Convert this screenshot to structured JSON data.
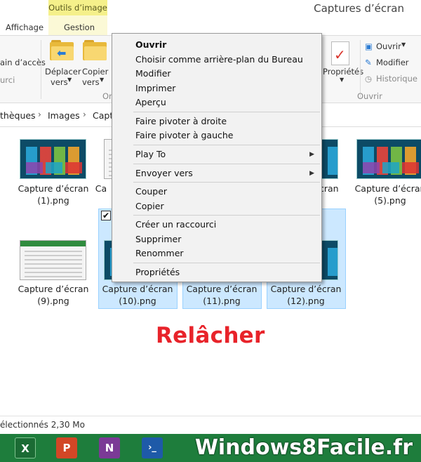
{
  "window": {
    "title": "Captures d’écran",
    "context_tab_group": "Outils d’image"
  },
  "tabs": {
    "affichage": "Affichage",
    "gestion": "Gestion"
  },
  "ribbon": {
    "access_partial": "ain d’accès",
    "group_partial": "urci",
    "move_to_1": "Déplacer",
    "move_to_2": "vers",
    "copy_to_1": "Copier",
    "copy_to_2": "vers",
    "organize_partial": "Or",
    "properties": "Propriétés",
    "open": "Ouvrir",
    "modify": "Modifier",
    "history": "Historique",
    "group_open": "Ouvrir"
  },
  "breadcrumb": {
    "item1": "thèques",
    "item2": "Images",
    "item3": "Captu"
  },
  "files": [
    {
      "label1": "Capture d’écran",
      "label2": "(1).png"
    },
    {
      "label1": "Ca",
      "label2": ""
    },
    {
      "label1": "cran",
      "label2": ""
    },
    {
      "label1": "Capture d’écran",
      "label2": "(5).png"
    },
    {
      "label1": "Capture d’écran",
      "label2": "(9).png"
    },
    {
      "label1": "Capture d’écran",
      "label2": "(10).png"
    },
    {
      "label1": "Capture d’écran",
      "label2": "(11).png"
    },
    {
      "label1": "Capture d’écran",
      "label2": "(12).png"
    }
  ],
  "overlay_text": "Relâcher",
  "status": {
    "text": "électionnés  2,30 Mo"
  },
  "context_menu": {
    "items": [
      "Ouvrir",
      "Choisir comme arrière-plan du Bureau",
      "Modifier",
      "Imprimer",
      "Aperçu",
      "Faire pivoter à droite",
      "Faire pivoter à gauche",
      "Play To",
      "Envoyer vers",
      "Couper",
      "Copier",
      "Créer un raccourci",
      "Supprimer",
      "Renommer",
      "Propriétés"
    ]
  },
  "taskbar": {
    "excel_label": "X",
    "powerpoint_label": "P",
    "onenote_label": "N",
    "powershell_label": "›_",
    "watermark": "Windows8Facile.fr"
  },
  "colors": {
    "taskbar": "#1e7d3c",
    "selection": "#cce8ff",
    "overlay_text": "#e8232a",
    "context_tab": "#f5f08a"
  }
}
